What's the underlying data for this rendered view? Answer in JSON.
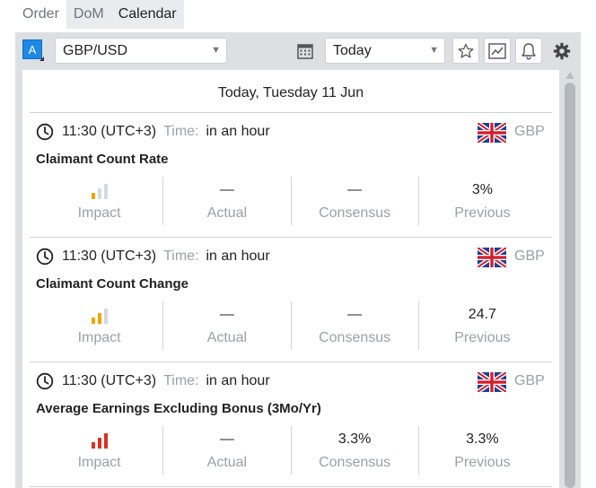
{
  "tabs": [
    {
      "label": "Order"
    },
    {
      "label": "DoM"
    },
    {
      "label": "Calendar"
    }
  ],
  "toolbar": {
    "symbol_badge": "A",
    "symbol": "GBP/USD",
    "period": "Today"
  },
  "icons": {
    "calendar": "calendar-icon",
    "star": "star-icon",
    "chart": "chart-icon",
    "bell": "bell-icon",
    "settings": "gear-icon"
  },
  "calendar": {
    "date_header": "Today, Tuesday 11 Jun",
    "events": [
      {
        "time": "11:30 (UTC+3)",
        "time_label": "Time:",
        "time_relative": "in an hour",
        "currency": "GBP",
        "title": "Claimant Count Rate",
        "impact_level": 1,
        "impact_color": "#f0a500",
        "actual": "—",
        "consensus": "—",
        "previous": "3%",
        "labels": {
          "impact": "Impact",
          "actual": "Actual",
          "consensus": "Consensus",
          "previous": "Previous"
        }
      },
      {
        "time": "11:30 (UTC+3)",
        "time_label": "Time:",
        "time_relative": "in an hour",
        "currency": "GBP",
        "title": "Claimant Count Change",
        "impact_level": 2,
        "impact_color": "#f0a500",
        "actual": "—",
        "consensus": "—",
        "previous": "24.7",
        "labels": {
          "impact": "Impact",
          "actual": "Actual",
          "consensus": "Consensus",
          "previous": "Previous"
        }
      },
      {
        "time": "11:30 (UTC+3)",
        "time_label": "Time:",
        "time_relative": "in an hour",
        "currency": "GBP",
        "title": "Average Earnings Excluding Bonus (3Mo/Yr)",
        "impact_level": 3,
        "impact_color": "#d93025",
        "actual": "—",
        "consensus": "3.3%",
        "previous": "3.3%",
        "labels": {
          "impact": "Impact",
          "actual": "Actual",
          "consensus": "Consensus",
          "previous": "Previous"
        }
      }
    ]
  }
}
